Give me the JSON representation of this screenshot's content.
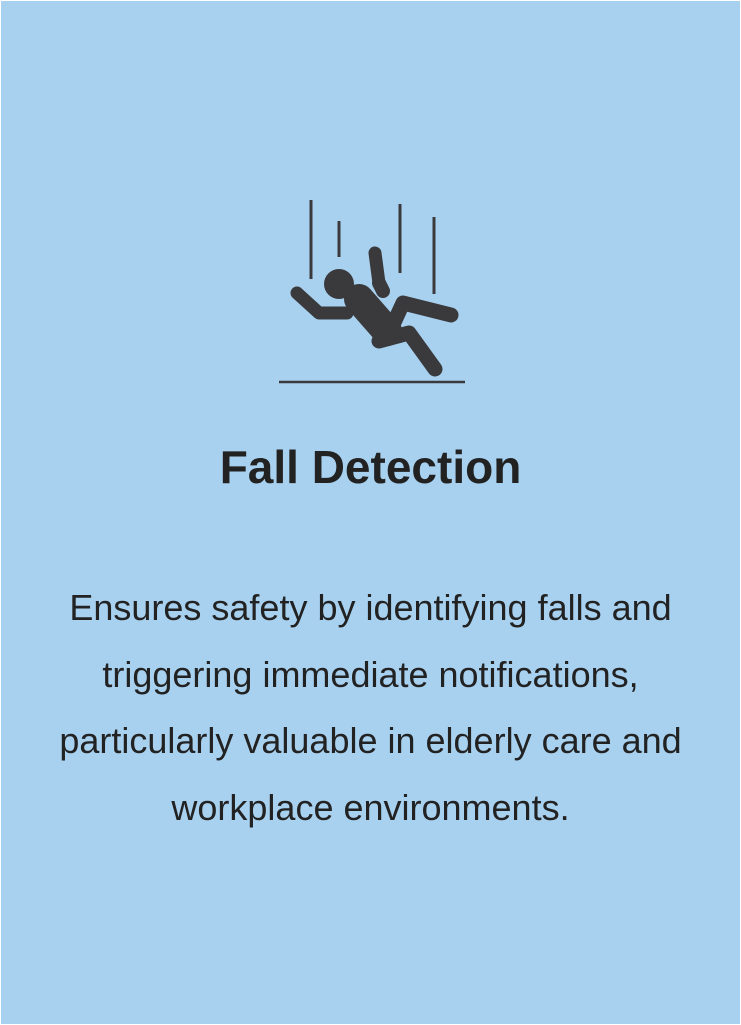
{
  "card": {
    "background": "#a8d1f0",
    "icon": "falling-person-icon",
    "icon_color": "#3a3a3c",
    "title": "Fall Detection",
    "description": "Ensures safety by identifying falls and triggering immediate notifications, particularly valuable in elderly care and workplace environments.",
    "text_color": "#222222"
  }
}
